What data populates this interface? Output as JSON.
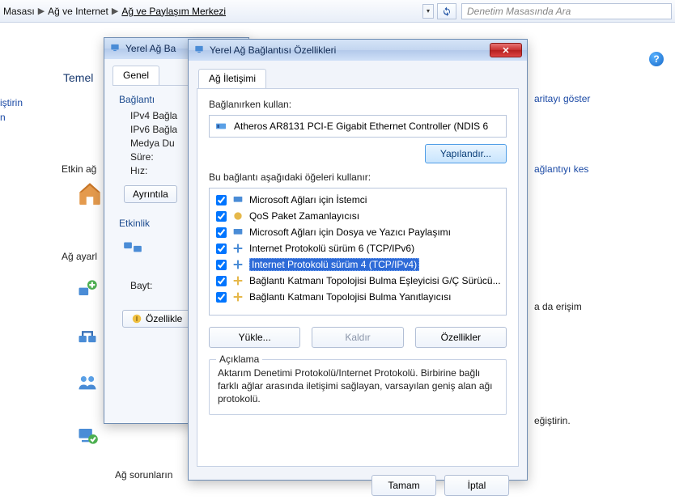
{
  "breadcrumb": {
    "p1": "Masası",
    "p2": "Ağ ve Internet",
    "p3": "Ağ ve Paylaşım Merkezi"
  },
  "search": {
    "placeholder": "Denetim Masasında Ara"
  },
  "left": {
    "heading": "Temel",
    "l1": "iştirin",
    "l2": "n"
  },
  "bg": {
    "etkinag": "Etkin ağ",
    "agayarl": "Ağ ayarl",
    "map": "aritayı göster",
    "disconnect": "ağlantıyı kes",
    "access": "a da erişim",
    "change": "eğiştirin.",
    "troubleshoot": "Ağ sorunların"
  },
  "status_window": {
    "title_cut": "Yerel Ağ Ba",
    "tab": "Genel",
    "section": "Bağlantı",
    "r1": "IPv4 Bağla",
    "r2": "IPv6 Bağla",
    "r3": "Medya Du",
    "r4": "Süre:",
    "r5": "Hız:",
    "details": "Ayrıntıla",
    "activity": "Etkinlik",
    "bytes": "Bayt:",
    "props": "Özellikle"
  },
  "dialog": {
    "title": "Yerel Ağ Bağlantısı Özellikleri",
    "tab": "Ağ İletişimi",
    "connect_using": "Bağlanırken kullan:",
    "adapter": "Atheros AR8131 PCI-E Gigabit Ethernet Controller (NDIS 6",
    "configure": "Yapılandır...",
    "uses_items": "Bu bağlantı aşağıdaki öğeleri kullanır:",
    "items": [
      "Microsoft Ağları için İstemci",
      "QoS Paket Zamanlayıcısı",
      "Microsoft Ağları için Dosya ve Yazıcı Paylaşımı",
      "Internet Protokolü sürüm 6 (TCP/IPv6)",
      "Internet Protokolü sürüm 4 (TCP/IPv4)",
      "Bağlantı Katmanı Topolojisi Bulma Eşleyicisi G/Ç Sürücü...",
      "Bağlantı Katmanı Topolojisi Bulma Yanıtlayıcısı"
    ],
    "install": "Yükle...",
    "uninstall": "Kaldır",
    "properties": "Özellikler",
    "desc_legend": "Açıklama",
    "desc": "Aktarım Denetimi Protokolü/Internet Protokolü. Birbirine bağlı farklı ağlar arasında iletişimi sağlayan, varsayılan geniş alan ağı protokolü.",
    "ok": "Tamam",
    "cancel": "İptal"
  }
}
